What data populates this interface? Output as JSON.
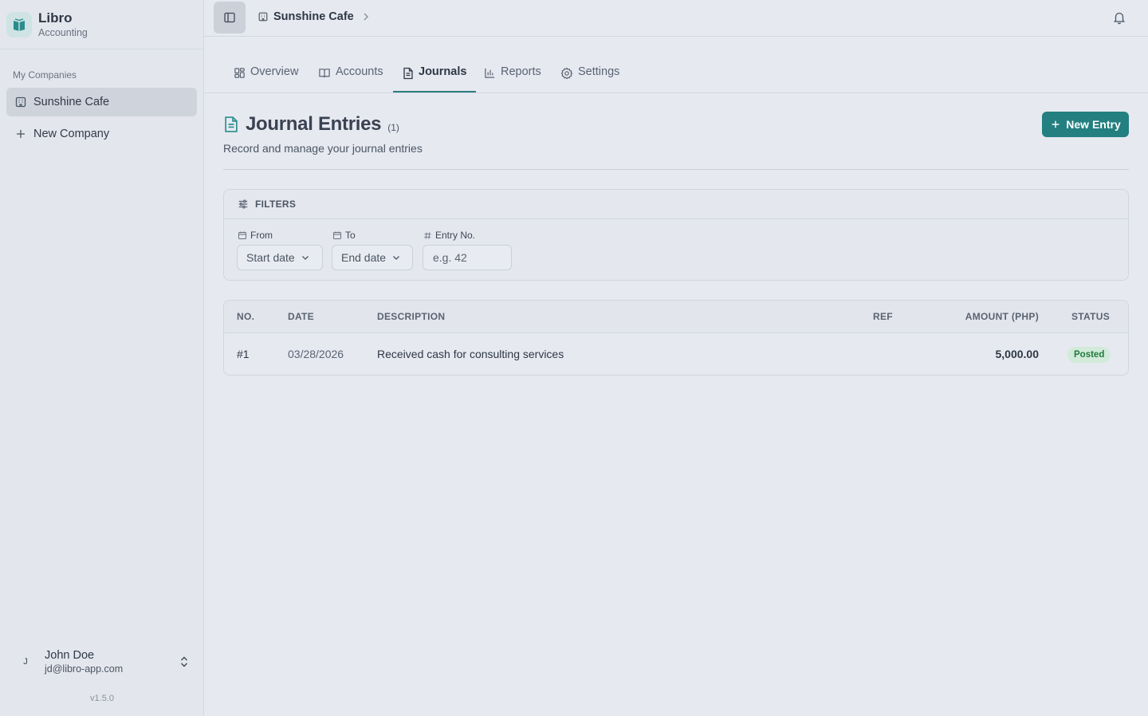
{
  "brand": {
    "name": "Libro",
    "subtitle": "Accounting",
    "accent": "#237f80"
  },
  "sidebar": {
    "section_label": "My Companies",
    "companies": [
      {
        "label": "Sunshine Cafe",
        "icon": "building-icon",
        "active": true
      }
    ],
    "new_company_label": "New Company",
    "user": {
      "initial": "J",
      "name": "John Doe",
      "email": "jd@libro-app.com"
    },
    "version": "v1.5.0"
  },
  "topbar": {
    "breadcrumb": "Sunshine Cafe"
  },
  "tabs": [
    {
      "label": "Overview",
      "icon": "grid-icon"
    },
    {
      "label": "Accounts",
      "icon": "book-icon"
    },
    {
      "label": "Journals",
      "icon": "document-icon",
      "active": true
    },
    {
      "label": "Reports",
      "icon": "bar-chart-icon"
    },
    {
      "label": "Settings",
      "icon": "gear-icon"
    }
  ],
  "page": {
    "title": "Journal Entries",
    "count": "(1)",
    "subtitle": "Record and manage your journal entries",
    "new_entry_label": "New Entry"
  },
  "filters": {
    "heading": "FILTERS",
    "from": {
      "label": "From",
      "value": "Start date"
    },
    "to": {
      "label": "To",
      "value": "End date"
    },
    "entry_no": {
      "label": "Entry No.",
      "placeholder": "e.g. 42"
    }
  },
  "table": {
    "columns": {
      "no": "NO.",
      "date": "DATE",
      "description": "DESCRIPTION",
      "ref": "REF",
      "amount": "AMOUNT (PHP)",
      "status": "STATUS"
    },
    "rows": [
      {
        "no": "#1",
        "date": "03/28/2026",
        "description": "Received cash for consulting services",
        "ref": "",
        "amount": "5,000.00",
        "status": "Posted"
      }
    ]
  }
}
